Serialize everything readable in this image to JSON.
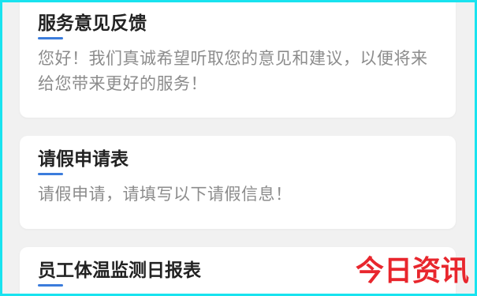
{
  "screen": {
    "background_color": "#f1f1f1",
    "frame_color": "#19e3ef",
    "accent_color": "#3b7cdc"
  },
  "cards": [
    {
      "title": "服务意见反馈",
      "description_lines": [
        "您好！我们真诚希望听取您的意见和建议，以便将来",
        "给您带来更好的服务！"
      ]
    },
    {
      "title": "请假申请表",
      "description_lines": [
        "请假申请，请填写以下请假信息！"
      ]
    },
    {
      "title": "员工体温监测日报表"
    }
  ],
  "watermark": {
    "text": "今日资讯",
    "color": "#e8262d"
  }
}
